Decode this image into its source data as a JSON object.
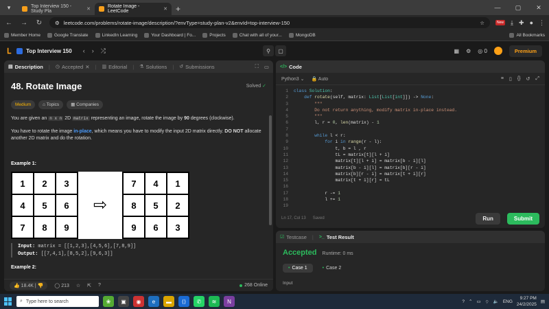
{
  "browser": {
    "tabs": [
      {
        "title": "Top Interview 150 - Study Pla"
      },
      {
        "title": "Rotate Image - LeetCode"
      }
    ],
    "url": "leetcode.com/problems/rotate-image/description/?envType=study-plan-v2&envId=top-interview-150",
    "new_badge": "New",
    "bookmarks": [
      "Member Home",
      "Google Translate",
      "LinkedIn Learning",
      "Your Dashboard | Fo...",
      "Projects",
      "Chat with all of your...",
      "MongoDB"
    ],
    "all_bookmarks": "All Bookmarks"
  },
  "topbar": {
    "list_title": "Top Interview 150",
    "coins": "0",
    "premium": "Premium"
  },
  "left_panel": {
    "tabs": [
      "Description",
      "Accepted",
      "Editorial",
      "Solutions",
      "Submissions"
    ],
    "problem_title": "48. Rotate Image",
    "solved": "Solved",
    "tags": [
      "Medium",
      "Topics",
      "Companies"
    ],
    "p1_a": "You are given an",
    "p1_code": "n x n",
    "p1_b": "2D",
    "p1_code2": "matrix",
    "p1_c": "representing an image, rotate the image by",
    "p1_bold": "90",
    "p1_d": "degrees (clockwise).",
    "p2_a": "You have to rotate the image",
    "p2_link": "in-place",
    "p2_b": ", which means you have to modify the input 2D matrix directly.",
    "p2_bold": "DO NOT",
    "p2_c": "allocate another 2D matrix and do the rotation.",
    "example1": "Example 1:",
    "input_matrix": [
      "1",
      "2",
      "3",
      "4",
      "5",
      "6",
      "7",
      "8",
      "9"
    ],
    "output_matrix": [
      "7",
      "4",
      "1",
      "8",
      "5",
      "2",
      "9",
      "6",
      "3"
    ],
    "input_label": "Input:",
    "input_value": "matrix = [[1,2,3],[4,5,6],[7,8,9]]",
    "output_label": "Output:",
    "output_value": "[[7,4,1],[8,5,2],[9,6,3]]",
    "example2": "Example 2:",
    "likes": "18.4K",
    "comments": "213",
    "online": "268 Online"
  },
  "code_panel": {
    "title": "Code",
    "language": "Python3",
    "auto": "Auto",
    "lines": [
      "class Solution:",
      "    def rotate(self, matrix: List[List[int]]) -> None:",
      "        \"\"\"",
      "        Do not return anything, modify matrix in-place instead.",
      "        \"\"\"",
      "        l, r = 0, len(matrix) - 1",
      "",
      "        while l < r:",
      "            for i in range(r - l):",
      "                t, b = l , r",
      "                tL = matrix[t][l + i]",
      "                matrix[t][l + i] = matrix[b - i][l]",
      "                matrix[b - i][l] = matrix[b][r - i]",
      "                matrix[b][r - i] = matrix[t + i][r]",
      "                matrix[t + i][r] = tL",
      "",
      "            r -= 1",
      "            l += 1",
      ""
    ],
    "cursor": "Ln 17, Col 13",
    "saved": "Saved",
    "run": "Run",
    "submit": "Submit"
  },
  "result_panel": {
    "tab_testcase": "Testcase",
    "tab_result": "Test Result",
    "status": "Accepted",
    "runtime": "Runtime: 0 ms",
    "cases": [
      "Case 1",
      "Case 2"
    ],
    "input_label": "Input"
  },
  "taskbar": {
    "search_placeholder": "Type here to search",
    "lang": "ENG",
    "time": "9:27 PM",
    "date": "24/2/2025"
  }
}
